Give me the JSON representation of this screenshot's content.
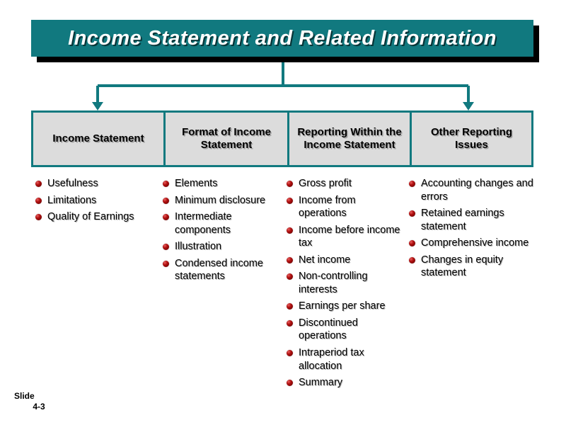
{
  "slide": {
    "title": "Income Statement and Related Information",
    "footer": {
      "label": "Slide",
      "number": "4-3"
    },
    "colors": {
      "accent_teal": "#11797f",
      "box_fill": "#dcdcdc",
      "bullet_red": "#b11010",
      "title_text": "#ffffff",
      "body_text": "#000000",
      "background": "#ffffff"
    }
  },
  "categories": [
    {
      "label": "Income Statement"
    },
    {
      "label": "Format of Income Statement"
    },
    {
      "label": "Reporting Within the Income Statement"
    },
    {
      "label": "Other Reporting Issues"
    }
  ],
  "columns": [
    {
      "heading": "Income Statement",
      "items": [
        "Usefulness",
        "Limitations",
        "Quality of Earnings"
      ]
    },
    {
      "heading": "Format of Income Statement",
      "items": [
        "Elements",
        "Minimum disclosure",
        "Intermediate components",
        "Illustration",
        "Condensed income statements"
      ]
    },
    {
      "heading": "Reporting Within the Income Statement",
      "items": [
        "Gross profit",
        "Income from operations",
        "Income before income tax",
        "Net income",
        "Non-controlling interests",
        "Earnings per share",
        "Discontinued operations",
        "Intraperiod tax allocation",
        "Summary"
      ]
    },
    {
      "heading": "Other Reporting Issues",
      "items": [
        "Accounting changes and errors",
        "Retained earnings statement",
        "Comprehensive income",
        "Changes in equity statement"
      ]
    }
  ]
}
